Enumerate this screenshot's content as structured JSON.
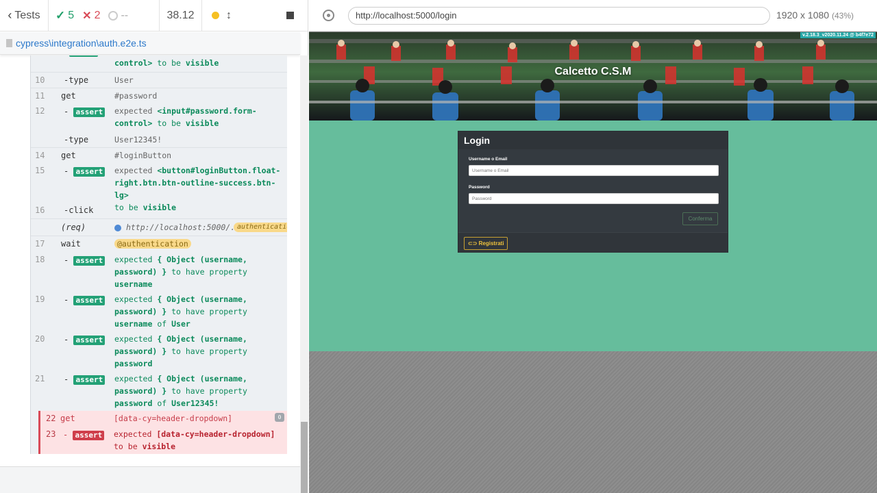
{
  "reporter": {
    "back_label": "Tests",
    "passed": "5",
    "failed": "2",
    "pending": "--",
    "duration": "38.12",
    "spec_path": "cypress\\integration\\auth.e2e.ts"
  },
  "commands": {
    "c9_tail": {
      "code": "control>",
      "text": "to be",
      "val": "visible"
    },
    "c10": {
      "num": "10",
      "name": "-type",
      "msg": "User"
    },
    "c11": {
      "num": "11",
      "name": "get",
      "msg": "#password"
    },
    "c12": {
      "num": "12",
      "name": "assert",
      "l1_a": "expected",
      "l1_b": "<input#password.form-",
      "l2_a": "control>",
      "l2_b": "to be",
      "l2_c": "visible"
    },
    "c12t": {
      "name": "-type",
      "msg": "User12345!"
    },
    "c14": {
      "num": "14",
      "name": "get",
      "msg": "#loginButton"
    },
    "c15": {
      "num": "15",
      "name": "assert",
      "l1_a": "expected",
      "l1_b": "<button#loginButton.float-",
      "l2": "right.btn.btn-outline-success.btn-lg>",
      "l3_a": "to be",
      "l3_b": "visible"
    },
    "c16": {
      "num": "16",
      "name": "-click"
    },
    "req": {
      "name": "(req)",
      "url": "http://localhost:5000/...",
      "alias": "authentication"
    },
    "c17": {
      "num": "17",
      "name": "wait",
      "alias": "@authentication"
    },
    "c18": {
      "num": "18",
      "name": "assert",
      "l1_a": "expected",
      "l1_b": "{ Object (username,",
      "l2_a": "password) }",
      "l2_b": "to have property",
      "l3": "username"
    },
    "c19": {
      "num": "19",
      "name": "assert",
      "l1_a": "expected",
      "l1_b": "{ Object (username,",
      "l2_a": "password) }",
      "l2_b": "to have property",
      "l3_a": "username",
      "l3_b": "of",
      "l3_c": "User"
    },
    "c20": {
      "num": "20",
      "name": "assert",
      "l1_a": "expected",
      "l1_b": "{ Object (username,",
      "l2_a": "password) }",
      "l2_b": "to have property",
      "l3": "password"
    },
    "c21": {
      "num": "21",
      "name": "assert",
      "l1_a": "expected",
      "l1_b": "{ Object (username,",
      "l2_a": "password) }",
      "l2_b": "to have property",
      "l3_a": "password",
      "l3_b": "of",
      "l3_c": "User12345!"
    },
    "c22": {
      "num": "22",
      "name": "get",
      "msg": "[data-cy=header-dropdown]",
      "count": "0"
    },
    "c23": {
      "num": "23",
      "name": "assert",
      "l1_a": "expected",
      "l1_b": "[data-cy=header-dropdown]",
      "l2_a": "to be",
      "l2_b": "visible"
    }
  },
  "aut": {
    "url": "http://localhost:5000/login",
    "viewport": "1920 x 1080",
    "zoom": "(43%)",
    "version_badge": "v.2.18.3_v2020.11.24 @ b4f7e72",
    "site_title": "Calcetto C.S.M",
    "login": {
      "title": "Login",
      "username_label": "Username o Email",
      "username_placeholder": "Username o Email",
      "password_label": "Password",
      "password_placeholder": "Password",
      "confirm_label": "Conferma",
      "register_label": "Registrati"
    }
  }
}
